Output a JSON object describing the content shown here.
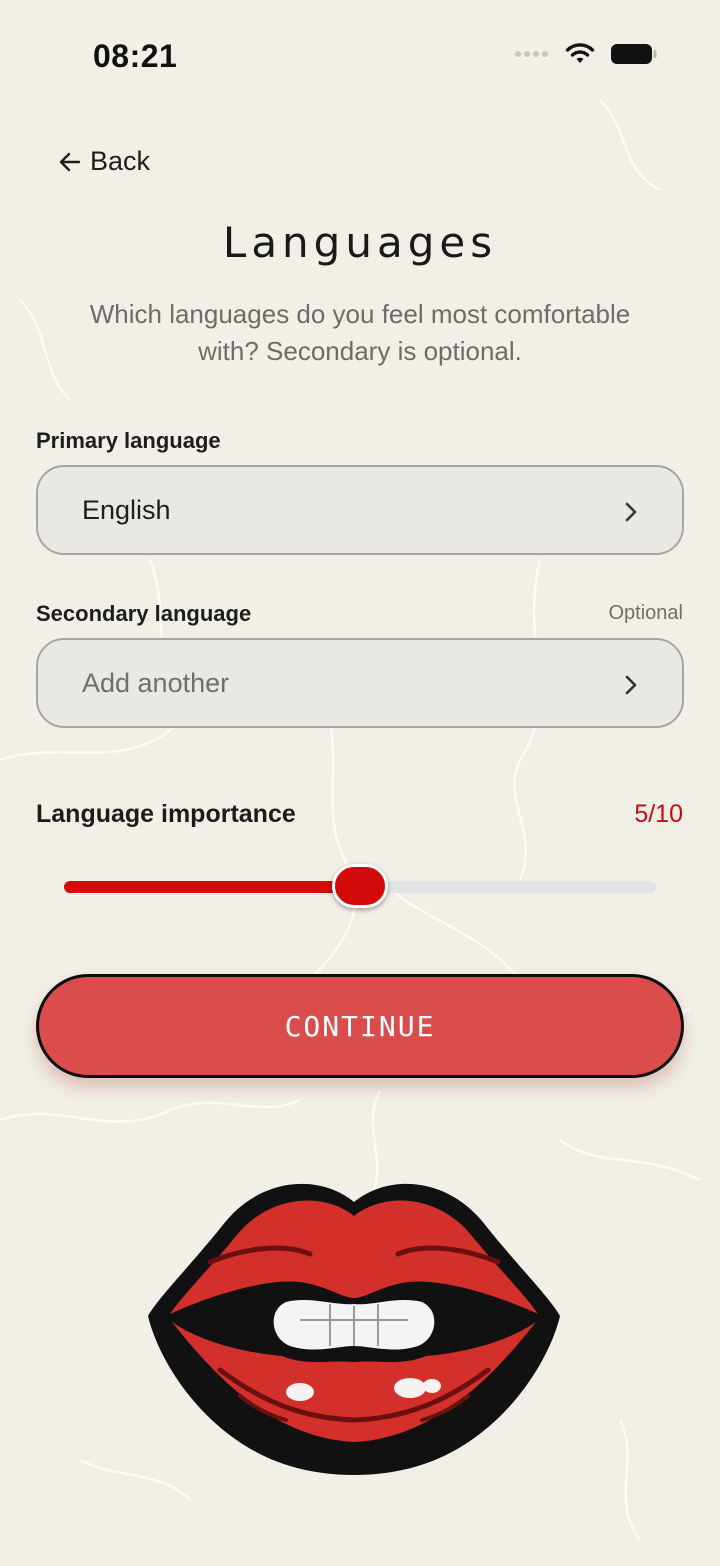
{
  "status_bar": {
    "time": "08:21",
    "icons": [
      "signal-dots-icon",
      "wifi-icon",
      "battery-icon"
    ]
  },
  "header": {
    "back_label": "Back",
    "title": "Languages",
    "subtitle": "Which languages do you feel most comfortable with? Secondary is optional."
  },
  "primary": {
    "label": "Primary language",
    "value": "English"
  },
  "secondary": {
    "label": "Secondary language",
    "optional_label": "Optional",
    "placeholder": "Add another"
  },
  "importance": {
    "label": "Language importance",
    "value_text": "5/10",
    "value": 5,
    "max": 10
  },
  "continue_label": "CONTINUE",
  "colors": {
    "background": "#f2efe6",
    "accent_red": "#d30b0b",
    "button_red": "#db4c4c",
    "value_red": "#c30d0d"
  }
}
